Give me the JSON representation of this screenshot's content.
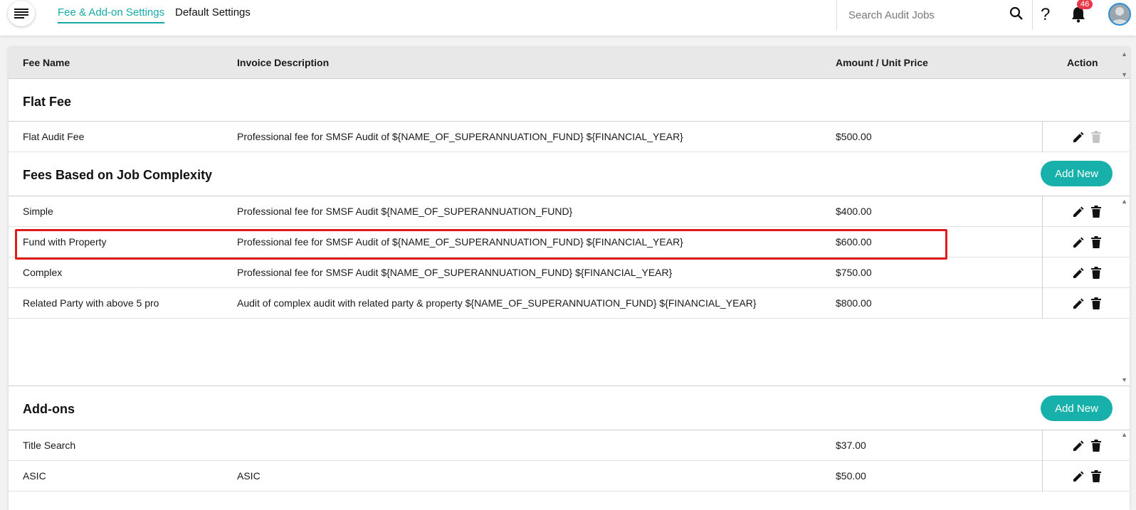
{
  "header": {
    "tabs": [
      {
        "label": "Fee & Add-on Settings",
        "active": true
      },
      {
        "label": "Default Settings",
        "active": false
      }
    ],
    "search": {
      "placeholder": "Search Audit Jobs",
      "value": ""
    },
    "help_label": "?",
    "notifications_count": "46",
    "icons": [
      "menu-icon",
      "search-icon",
      "help-icon",
      "bell-icon",
      "avatar"
    ]
  },
  "table": {
    "columns": [
      "Fee Name",
      "Invoice Description",
      "Amount / Unit Price",
      "Action"
    ]
  },
  "sections": {
    "flat": {
      "title": "Flat Fee",
      "rows": [
        {
          "name": "Flat Audit Fee",
          "description": "Professional fee for SMSF Audit of ${NAME_OF_SUPERANNUATION_FUND} ${FINANCIAL_YEAR}",
          "amount": "$500.00",
          "delete_disabled": true
        }
      ]
    },
    "complexity": {
      "title": "Fees Based on Job Complexity",
      "add_label": "Add New",
      "rows": [
        {
          "name": "Simple",
          "description": "Professional fee for SMSF Audit ${NAME_OF_SUPERANNUATION_FUND}",
          "amount": "$400.00"
        },
        {
          "name": "Fund with Property",
          "description": "Professional fee for SMSF Audit of ${NAME_OF_SUPERANNUATION_FUND} ${FINANCIAL_YEAR}",
          "amount": "$600.00",
          "highlighted": true
        },
        {
          "name": "Complex",
          "description": "Professional fee for SMSF Audit ${NAME_OF_SUPERANNUATION_FUND} ${FINANCIAL_YEAR}",
          "amount": "$750.00"
        },
        {
          "name": "Related Party with above 5 pro",
          "description": "Audit of complex audit with related party & property ${NAME_OF_SUPERANNUATION_FUND} ${FINANCIAL_YEAR}",
          "amount": "$800.00"
        }
      ]
    },
    "addons": {
      "title": "Add-ons",
      "add_label": "Add New",
      "rows": [
        {
          "name": "Title Search",
          "description": "",
          "amount": "$37.00"
        },
        {
          "name": "ASIC",
          "description": "ASIC",
          "amount": "$50.00"
        }
      ]
    }
  },
  "colors": {
    "accent": "#17b0ab",
    "highlight_box": "#e01b1b",
    "badge": "#e8394a"
  }
}
